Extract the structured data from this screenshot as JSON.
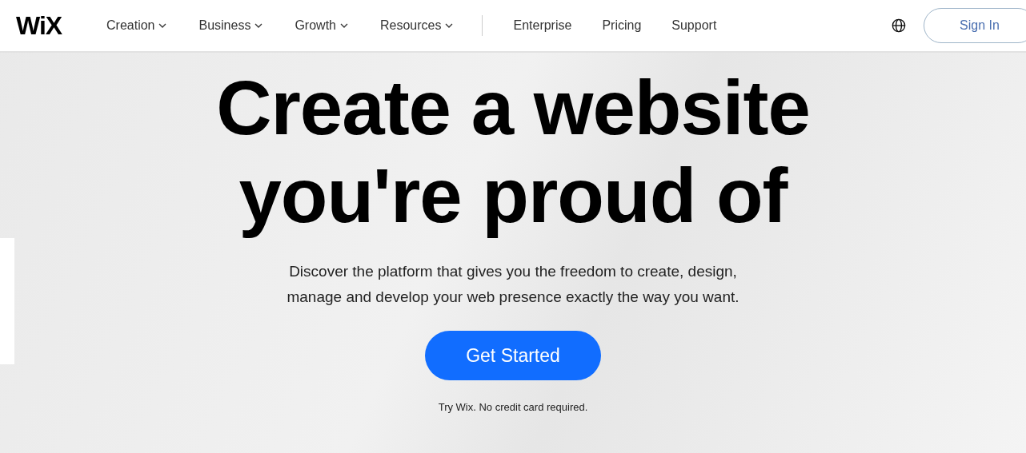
{
  "header": {
    "logo": "WiX",
    "nav": [
      {
        "label": "Creation",
        "kind": "dropdown"
      },
      {
        "label": "Business",
        "kind": "dropdown"
      },
      {
        "label": "Growth",
        "kind": "dropdown"
      },
      {
        "label": "Resources",
        "kind": "dropdown"
      },
      {
        "label": "Enterprise",
        "kind": "link"
      },
      {
        "label": "Pricing",
        "kind": "link"
      },
      {
        "label": "Support",
        "kind": "link"
      }
    ],
    "sign_in": "Sign In"
  },
  "hero": {
    "headline_lines": [
      "Create a website",
      "you're proud of"
    ],
    "subtitle_lines": [
      "Discover the platform that gives you the freedom to create, design,",
      "manage and develop your web presence exactly the way you want."
    ],
    "cta": "Get Started",
    "note": "Try Wix. No credit card required."
  }
}
